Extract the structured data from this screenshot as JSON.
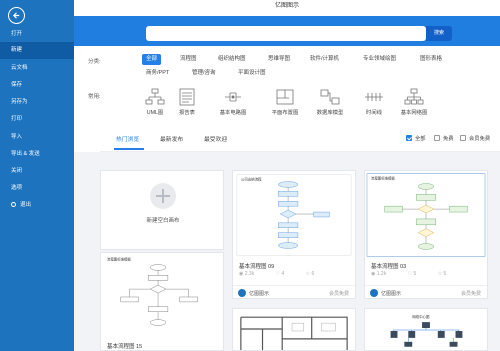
{
  "app": {
    "title": "亿图图示"
  },
  "sidebar": {
    "items": [
      {
        "label": "打开"
      },
      {
        "label": "新建"
      },
      {
        "label": "云文档"
      },
      {
        "label": "保存"
      },
      {
        "label": "另存为"
      },
      {
        "label": "打印"
      },
      {
        "label": "导入"
      },
      {
        "label": "导出 & 发送"
      },
      {
        "label": "关闭"
      },
      {
        "label": "选项"
      },
      {
        "label": "退出"
      }
    ]
  },
  "search": {
    "placeholder": "",
    "button_label": "搜索"
  },
  "filters": {
    "category_label": "分类:",
    "categories": [
      "全部",
      "流程图",
      "组织结构图",
      "思维导图",
      "软件/计算机",
      "专业领域绘图",
      "图形表格",
      "商务/PPT",
      "管理/咨询",
      "平面设计图"
    ],
    "common_label": "常用:",
    "common": [
      {
        "label": "UML图",
        "icon": "uml-icon"
      },
      {
        "label": "报告表",
        "icon": "report-icon"
      },
      {
        "label": "基本电路图",
        "icon": "circuit-icon"
      },
      {
        "label": "平面布置图",
        "icon": "floorplan-icon"
      },
      {
        "label": "数据库模型",
        "icon": "database-icon"
      },
      {
        "label": "时间线",
        "icon": "timeline-icon"
      },
      {
        "label": "基本网络图",
        "icon": "network-icon"
      }
    ]
  },
  "tabs": [
    {
      "label": "热门浏览"
    },
    {
      "label": "最新发布"
    },
    {
      "label": "最受欢迎"
    }
  ],
  "checks": [
    {
      "label": "全部",
      "checked": true
    },
    {
      "label": "免费",
      "checked": false
    },
    {
      "label": "会员免费",
      "checked": false
    }
  ],
  "cards": {
    "new_blank": {
      "label": "新建空白画布"
    },
    "c1": {
      "title": "基本流程图 09",
      "views": "2.3k",
      "likes": "4",
      "favs": "6",
      "author": "亿图图示",
      "price": "会员免费",
      "thumb_title": "公司出纳流程"
    },
    "c2": {
      "title": "基本流程图 03",
      "views": "1.2k",
      "likes": "5",
      "favs": "5",
      "author": "亿图图示",
      "price": "会员免费",
      "thumb_title": "流程图标准模板"
    },
    "c3": {
      "title": "基本流程图 15",
      "thumb_title": "流程图标准模板"
    },
    "c6": {
      "thumb_title": "网络中心图"
    }
  },
  "colors": {
    "sidebar": "#1e73be",
    "accent": "#2480e6",
    "hero": "#1f7ee0"
  }
}
